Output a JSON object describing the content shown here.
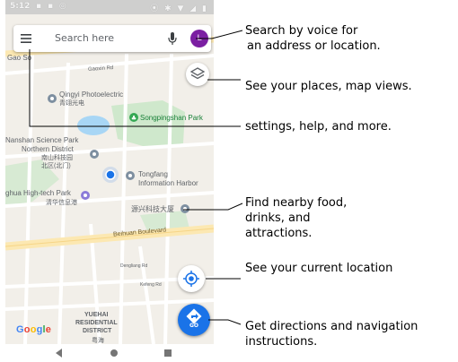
{
  "status_bar": {
    "time": "5:12",
    "left_icons_text": "▪ ▪ ◎",
    "right_icons_text": "⦿ ✱ ▼ ◢ ▮"
  },
  "search": {
    "placeholder": "Search here",
    "avatar_initial": "L"
  },
  "map": {
    "places": {
      "gao_so": "Gao So",
      "hall": "Gaoxin Rd",
      "qingyi_en": "Qingyi Photoelectric",
      "qingyi_cn": "青翊光电",
      "songpingshan": "Songpingshan Park",
      "nanshan": "Nanshan Science Park",
      "northern_district": "Northern District",
      "nanshan_cn1": "南山科技园",
      "nanshan_cn2": "北区(北门)",
      "tongfang1": "Tongfang",
      "tongfang2": "Information Harbor",
      "ghua": "ghua High-tech Park",
      "ghua_cn": "清华信息港",
      "yuanxing_cn": "源兴科技大厦",
      "beihuan": "Beihuan Boulevard",
      "dengliang": "Dengliang Rd",
      "kefeng": "Kefeng Rd",
      "yuehai1": "YUEHAI",
      "yuehai2": "RESIDENTIAL",
      "yuehai3": "DISTRICT",
      "yuehai_cn": "粤海"
    },
    "go_label": "GO",
    "google_logo": [
      "G",
      "o",
      "o",
      "g",
      "l",
      "e"
    ],
    "google_colors": [
      "#4285F4",
      "#EA4335",
      "#FBBC05",
      "#4285F4",
      "#34A853",
      "#EA4335"
    ]
  },
  "callouts": {
    "voice_line1": "Search by voice for",
    "voice_line2": "an address or location.",
    "places": "See your places, map views.",
    "settings": "settings, help, and  more.",
    "food_line1": "Find nearby food,",
    "food_line2": "drinks, and",
    "food_line3": "attractions.",
    "current_location": "See your current location",
    "directions_line1": "Get directions and navigation",
    "directions_line2": "instructions."
  },
  "colors": {
    "map_bg": "#f2efe9",
    "park": "#c8e6c9",
    "water": "#aadaff",
    "major_road": "#fce8b2",
    "accent_blue": "#1a73e8",
    "avatar_purple": "#7b1fa2"
  }
}
